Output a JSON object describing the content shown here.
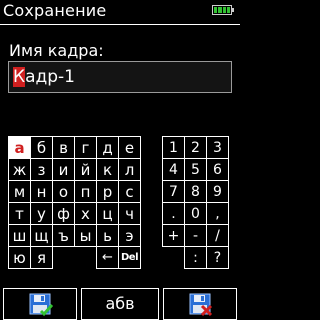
{
  "header": {
    "title": "Сохранение",
    "battery": {
      "level_fraction": 1.0,
      "color": "#33c233"
    }
  },
  "form": {
    "label": "Имя кадра:",
    "value_cursor_char": "К",
    "value_rest": "адр-1"
  },
  "keyboard": {
    "rows": [
      [
        "а",
        "б",
        "в",
        "г",
        "д",
        "е"
      ],
      [
        "ж",
        "з",
        "и",
        "й",
        "к",
        "л"
      ],
      [
        "м",
        "н",
        "о",
        "п",
        "р",
        "с"
      ],
      [
        "т",
        "у",
        "ф",
        "х",
        "ц",
        "ч"
      ],
      [
        "ш",
        "щ",
        "ъ",
        "ы",
        "ь",
        "э"
      ],
      [
        "ю",
        "я",
        "",
        "",
        "←",
        "Del"
      ]
    ],
    "selected": "а"
  },
  "numpad": {
    "rows": [
      [
        "1",
        "2",
        "3"
      ],
      [
        "4",
        "5",
        "6"
      ],
      [
        "7",
        "8",
        "9"
      ],
      [
        ".",
        "0",
        ","
      ],
      [
        "+",
        "-",
        "/"
      ],
      [
        "",
        ":",
        "?"
      ]
    ]
  },
  "footer": {
    "save_icon": "floppy-save-check-icon",
    "mode_label": "абв",
    "cancel_icon": "floppy-cancel-x-icon"
  },
  "colors": {
    "background": "#000000",
    "foreground": "#ffffff",
    "accent_red": "#d02020",
    "accent_green": "#33c233",
    "accent_blue": "#2a6fd6"
  }
}
